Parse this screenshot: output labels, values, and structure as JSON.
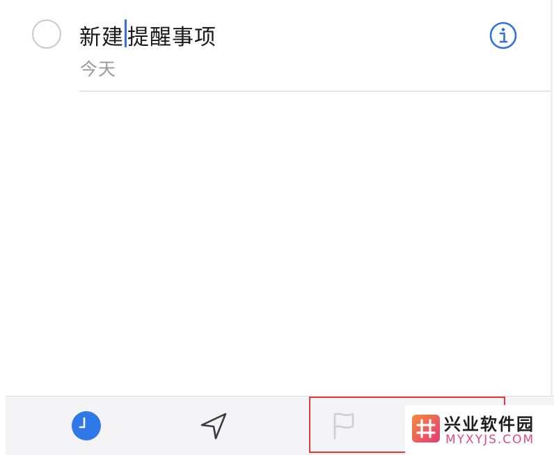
{
  "reminder": {
    "title_before_caret": "新建",
    "title_after_caret": "提醒事项",
    "date_label": "今天"
  },
  "toolbar": {
    "buttons": [
      {
        "name": "time",
        "icon": "clock-icon",
        "color": "#2f78e8"
      },
      {
        "name": "location",
        "icon": "location-arrow-icon",
        "color": "#3a3a3a"
      },
      {
        "name": "flag",
        "icon": "flag-icon",
        "color": "#cfcfcf"
      }
    ],
    "highlight_color": "#e23a3a"
  },
  "watermark": {
    "title": "兴业软件园",
    "domain": "MYXYJS.COM"
  },
  "colors": {
    "accent": "#2f78e8",
    "info_icon": "#2f6fe0",
    "date_text": "#9a9a9a"
  }
}
